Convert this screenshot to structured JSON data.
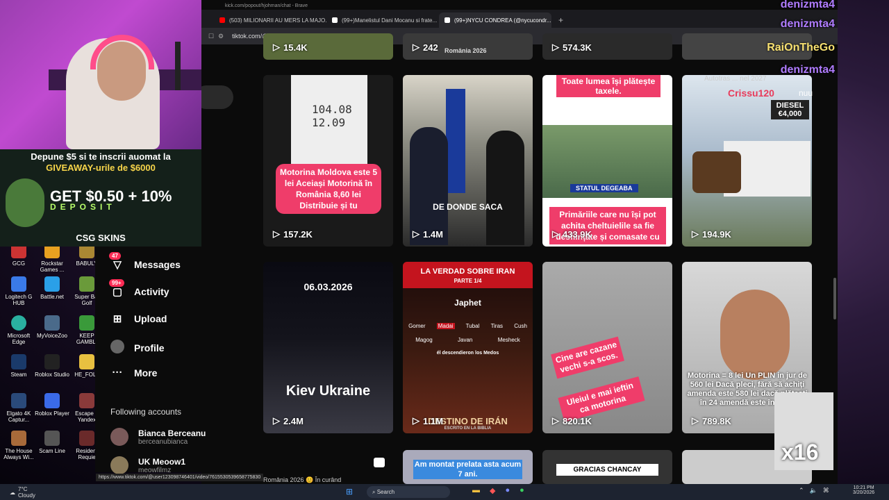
{
  "browser": {
    "popout_title": "kick.com/popout/hjohman/chat - Brave",
    "tabs": [
      {
        "label": "(503) MILIONARII AU MERS LA MAJO...",
        "active": false
      },
      {
        "label": "(99+)Manelistul Dani Mocanu si frate...",
        "active": false
      },
      {
        "label": "(99+)NYCU CONDREA (@nycucondr...",
        "active": true
      }
    ],
    "new_tab": "+",
    "url": "tiktok.com/@nycucondrea",
    "status_url": "https://www.tiktok.com/@user123098746401/video/7615530539658775830"
  },
  "sidebar": {
    "items": [
      {
        "label": "Messages",
        "badge": "47",
        "icon": "paper-plane-icon"
      },
      {
        "label": "Activity",
        "badge": "99+",
        "icon": "inbox-icon"
      },
      {
        "label": "Upload",
        "badge": "",
        "icon": "plus-square-icon"
      },
      {
        "label": "Profile",
        "badge": "",
        "icon": "avatar-icon"
      },
      {
        "label": "More",
        "badge": "",
        "icon": "more-icon"
      }
    ],
    "following_title": "Following accounts",
    "accounts": [
      {
        "name": "Bianca Berceanu",
        "handle": "berceanubianca"
      },
      {
        "name": "UK Meoow1",
        "handle": "meowfilmz"
      }
    ]
  },
  "videos": {
    "top_row_views": [
      "15.4K",
      "242",
      "574.3K"
    ],
    "top_row_cap": "România 2026",
    "row1": [
      {
        "views": "157.2K",
        "caption": "Motorina Moldova este 5 lei Aceiași Motorină în România 8,60 lei Distribuie și tu",
        "pump": "104.08 12.09"
      },
      {
        "views": "1.4M",
        "caption": "DE DONDE SACA"
      },
      {
        "views": "433.9K",
        "caption": "Toate lumea își plătește taxele.",
        "caption2": "Primăriile care nu își pot achita cheltuielile sa fie desființate și comasate cu",
        "tag": "STATUL DEGEABA"
      },
      {
        "views": "194.9K",
        "caption": "DIESEL €4,000"
      }
    ],
    "row2": [
      {
        "views": "2.4M",
        "date": "06.03.2026",
        "caption": "Kiev Ukraine"
      },
      {
        "views": "1.1M",
        "title": "LA VERDAD SOBRE IRAN",
        "part": "PARTE 1/4",
        "names": [
          "Japhet",
          "Gomer",
          "Madai",
          "Tubal",
          "Tiras",
          "Cush",
          "Magog",
          "Javan",
          "Mesheck"
        ],
        "sub": "él descendieron los Medos",
        "bottom": "DESTINO DE IRÁN",
        "bottom2": "ESCRITO EN LA BIBLIA"
      },
      {
        "views": "820.1K",
        "caption": "Cine are cazane vechi s-a scos.",
        "caption2": "Uleiul e mai ieftin ca motorina"
      },
      {
        "views": "789.8K",
        "caption": "Motorina = 8 lei Un PLIN in jur de 560 lei Dacă pleci, fără să achiți amenda este 580 lei dacă plătești în 24 amendă este în jumă"
      }
    ],
    "row3": [
      {
        "caption": "Am montat prelata asta acum 7 ani."
      },
      {
        "caption": "GRACIAS CHANCAY"
      }
    ],
    "row3_left": "România 2026 😊 În curând"
  },
  "stream": {
    "promo_line1": "Depune $5 si te inscrii auomat la",
    "promo_line2": "GIVEAWAY-urile de $6000",
    "promo_big": "GET $0.50 + 10%",
    "promo_sub": "DEPOSIT",
    "promo_brand": "CSG SKINS",
    "chat_users": [
      "denizmta4",
      "denizmta4",
      "RaiOnTheGo",
      "denizmta4",
      "Crissu120"
    ],
    "chat_msg": "nuu",
    "sticker_text": "x16",
    "autotras": "Autotras ... nel 2027"
  },
  "desktop": {
    "icons": [
      "GCG",
      "Rockstar Games ...",
      "BABULY",
      "Logitech G HUB",
      "Battle.net",
      "Super Bat Golf",
      "Microsoft Edge",
      "MyVoiceZoo",
      "KEEP GAMBLI",
      "Steam",
      "Roblox Studio",
      "HE_FOLL",
      "Elgato 4K Captur...",
      "Roblox Player",
      "Escape fr Yandex",
      "The House Always Wi...",
      "Scam Line",
      "Resident Requie"
    ]
  },
  "taskbar": {
    "weather_temp": "7°C",
    "weather_desc": "Cloudy",
    "search": "Search",
    "time": "10:21 PM",
    "date": "3/20/2026"
  }
}
